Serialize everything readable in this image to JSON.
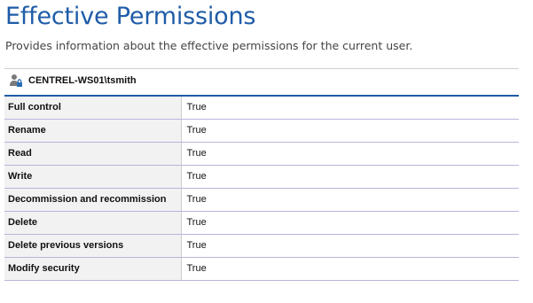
{
  "page": {
    "title": "Effective Permissions",
    "subtitle": "Provides information about the effective permissions for the current user."
  },
  "user": {
    "icon": "user-lock-icon",
    "name": "CENTREL-WS01\\tsmith"
  },
  "permissions": [
    {
      "name": "Full control",
      "value": "True"
    },
    {
      "name": "Rename",
      "value": "True"
    },
    {
      "name": "Read",
      "value": "True"
    },
    {
      "name": "Write",
      "value": "True"
    },
    {
      "name": "Decommission and recommission",
      "value": "True"
    },
    {
      "name": "Delete",
      "value": "True"
    },
    {
      "name": "Delete previous versions",
      "value": "True"
    },
    {
      "name": "Modify security",
      "value": "True"
    }
  ],
  "colors": {
    "title": "#1f5ca8",
    "table_border_top": "#1f5ca8",
    "row_divider": "#b8b5dc",
    "label_cell_bg": "#f2f2f2"
  }
}
